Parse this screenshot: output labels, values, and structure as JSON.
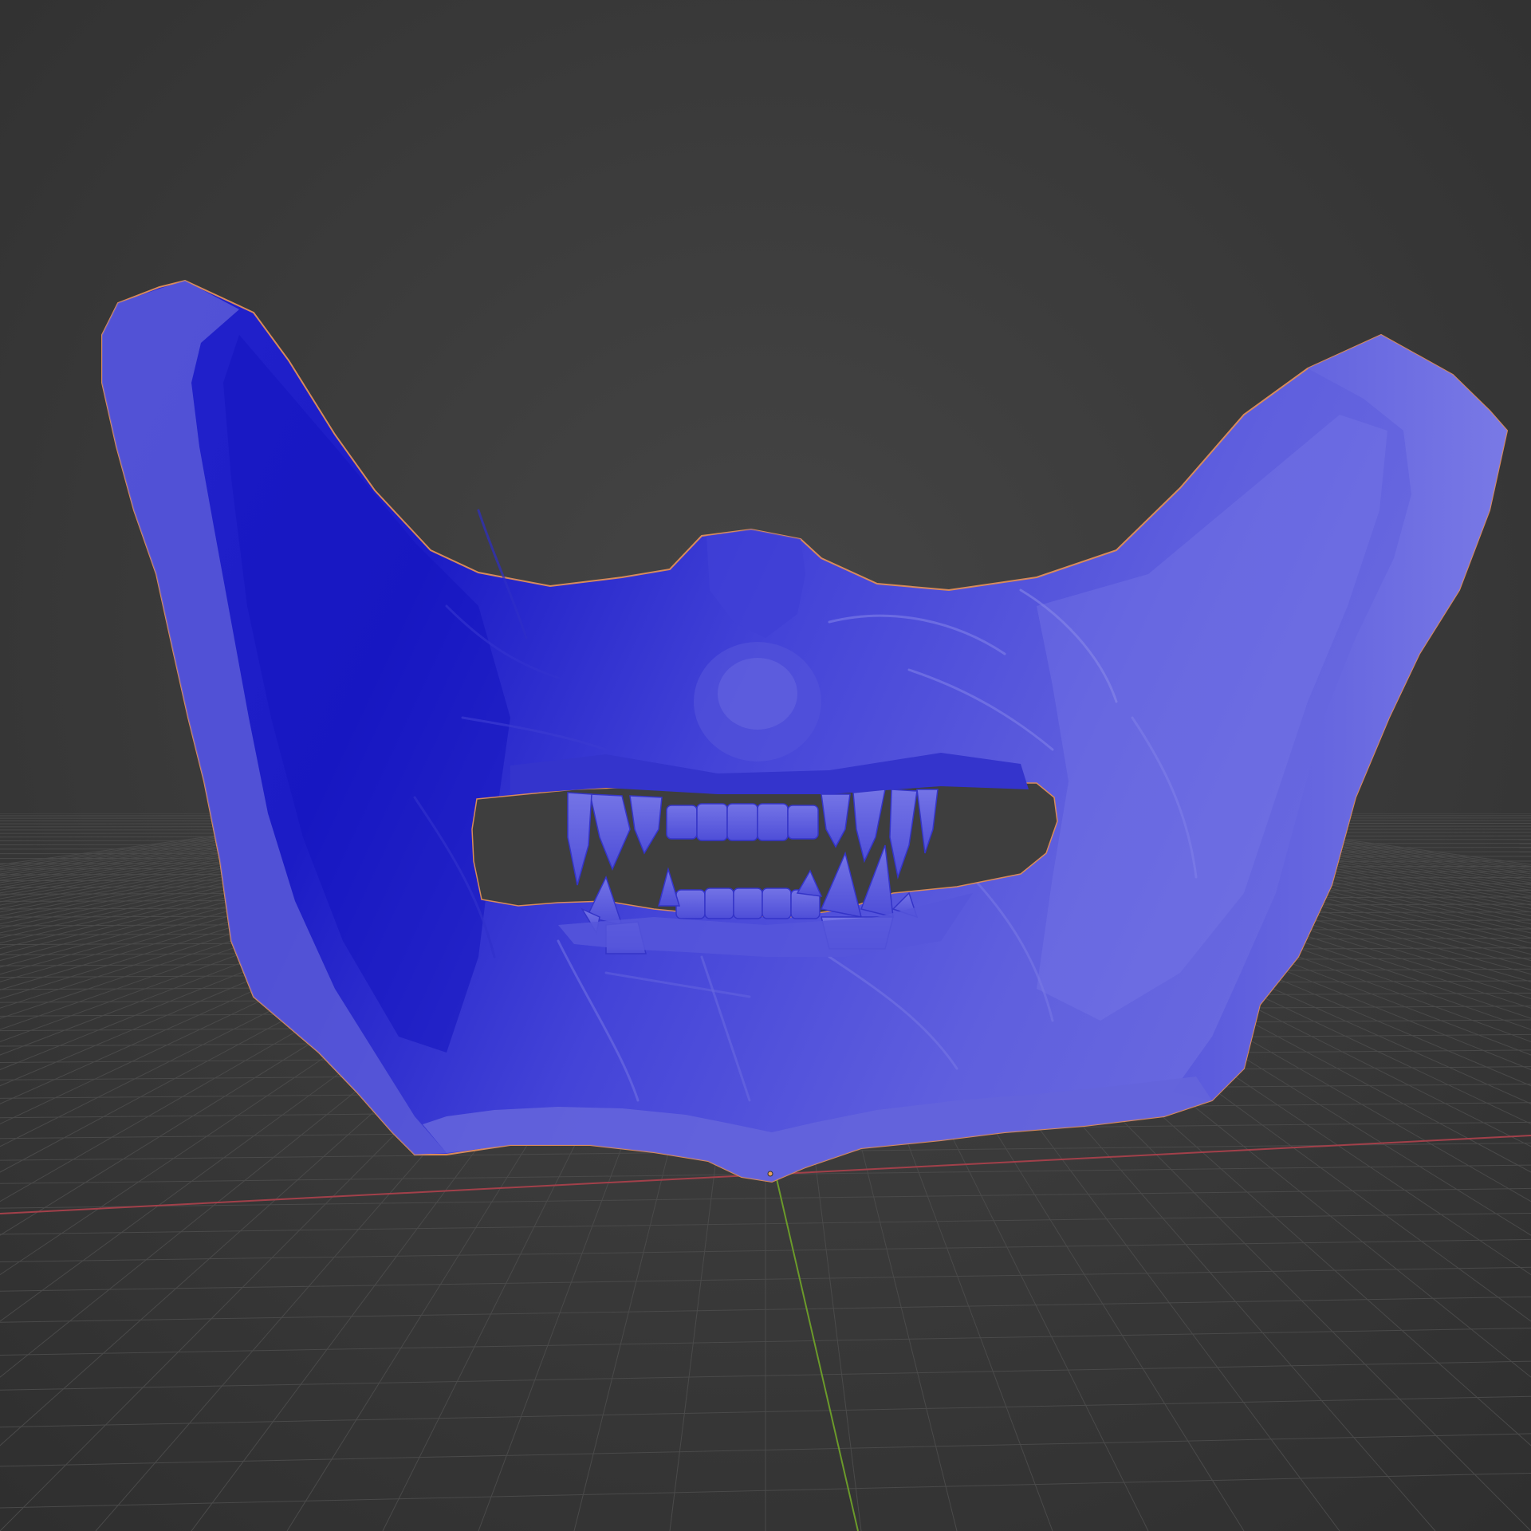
{
  "viewport": {
    "view": "3d-viewport",
    "shading": "solid",
    "background_color": "#3d3d3d",
    "background_top_color": "#353535",
    "grid_line_color": "#4a4a4a",
    "x_axis_color": "#a2404a",
    "y_axis_color": "#6b9a2a"
  },
  "object": {
    "name_icon": "oni-mask-mesh",
    "base_color": "#4a4ae6",
    "dark_color": "#1818c8",
    "light_color": "#7878ea",
    "selection_outline_color": "#d88a5a",
    "selected": true
  }
}
